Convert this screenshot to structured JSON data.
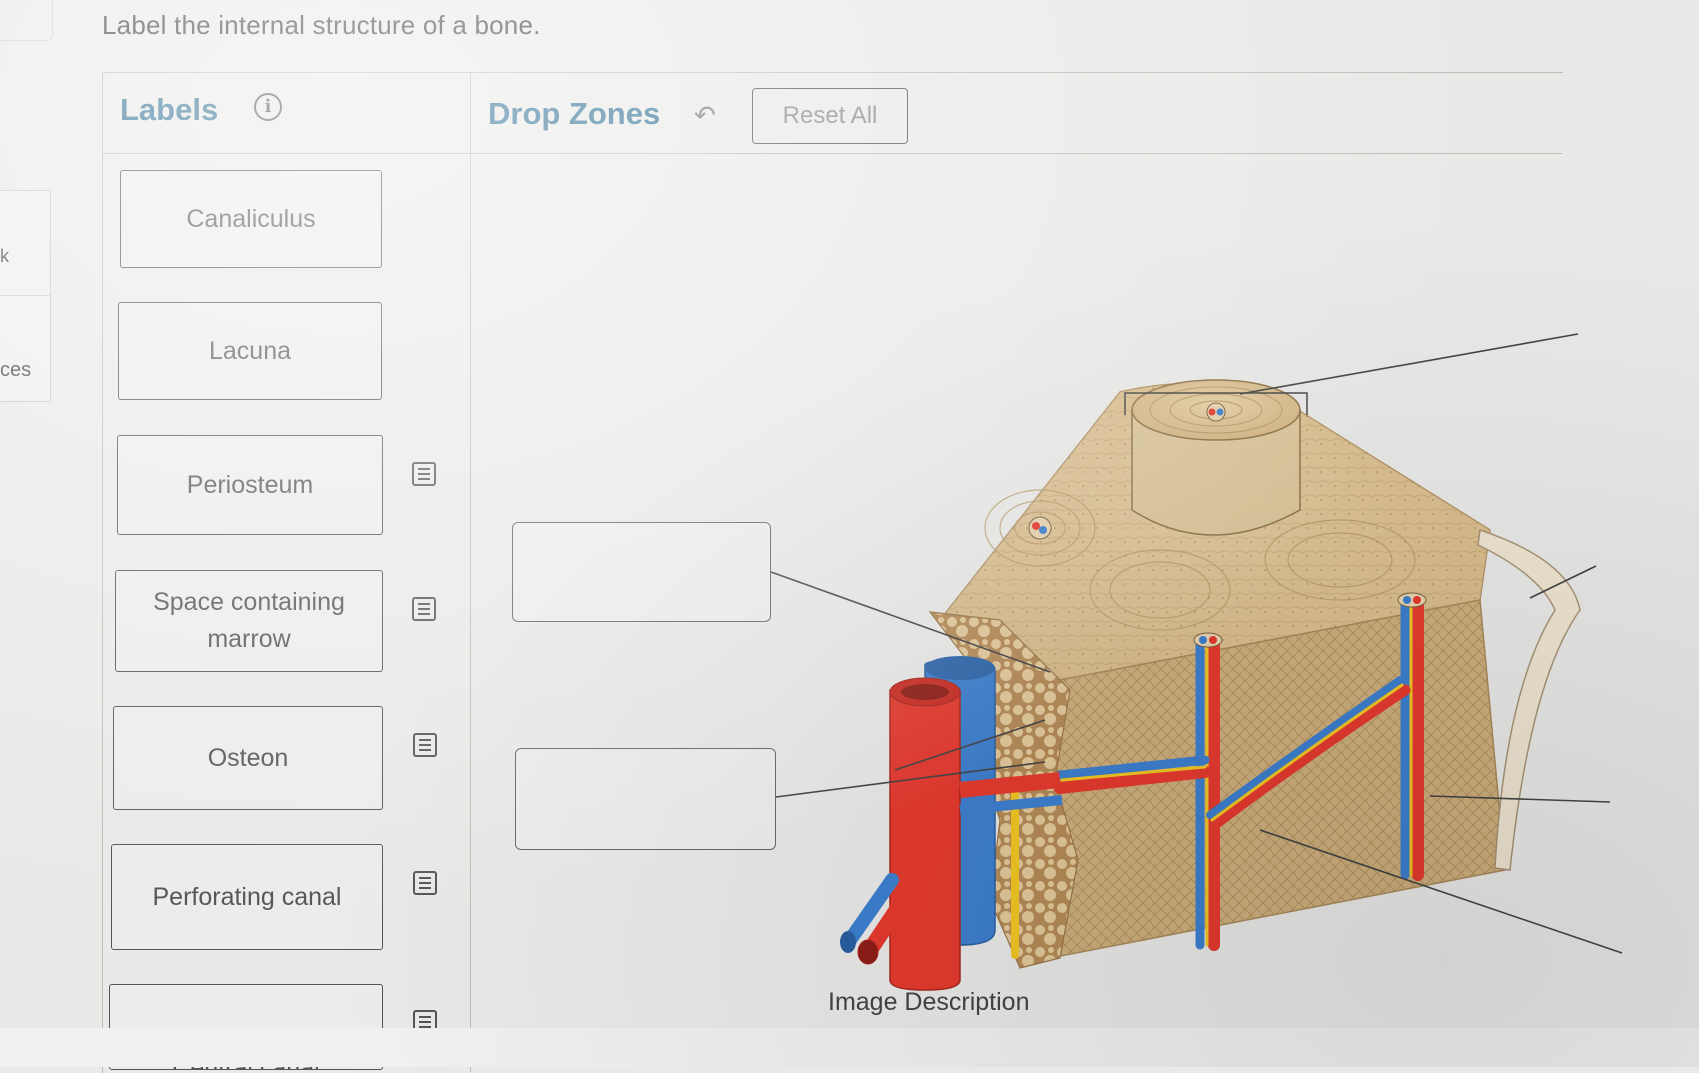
{
  "question": "Label the internal structure of a bone.",
  "sidebar": {
    "fragment_top": "k",
    "fragment_bottom": "ces"
  },
  "labels_panel": {
    "title": "Labels",
    "items": [
      {
        "text": "Canaliculus"
      },
      {
        "text": "Lacuna"
      },
      {
        "text": "Periosteum"
      },
      {
        "text": "Space containing marrow"
      },
      {
        "text": "Osteon"
      },
      {
        "text": "Perforating canal"
      },
      {
        "text": "Central canal"
      }
    ]
  },
  "drop_zones_panel": {
    "title": "Drop Zones",
    "reset_label": "Reset All"
  },
  "image": {
    "description_link": "Image Description"
  },
  "colors": {
    "heading": "#2f6f93",
    "bone": "#d8b888",
    "artery": "#e53a2e",
    "vein": "#3d7fcf",
    "nerve": "#f2c623"
  }
}
